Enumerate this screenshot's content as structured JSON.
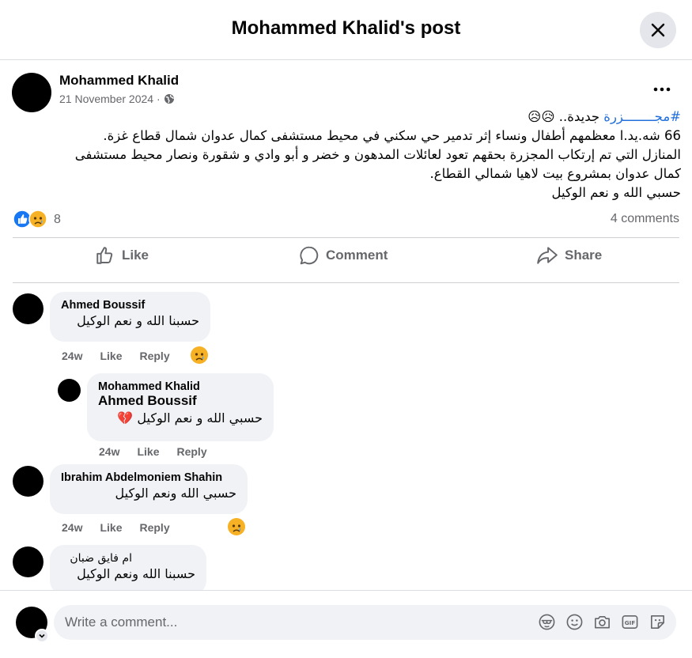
{
  "header": {
    "title": "Mohammed Khalid's post"
  },
  "post": {
    "author": "Mohammed Khalid",
    "date": "21 November 2024 ·",
    "text_lines": [
      "#مجــــــــزرة جديدة.. 😥😥",
      "66 شه.يد.ا معظمهم أطفال ونساء إثر تدمير حي سكني في محيط مستشفى كمال عدوان شمال قطاع غزة.",
      "المنازل التي تم إرتكاب المجزرة بحقهم تعود لعائلات المدهون و خضر و أبو وادي و شقورة ونصار محيط مستشفى",
      "كمال عدوان بمشروع بيت لاهيا شمالي القطاع.",
      "حسبي الله و نعم الوكيل"
    ],
    "hashtag": "#مجــــــــزرة",
    "line1_rest": " جديدة.. 😥😥",
    "reaction_count": "8",
    "comments_count": "4 comments"
  },
  "actions": {
    "like": "Like",
    "comment": "Comment",
    "share": "Share"
  },
  "comments": [
    {
      "name": "Ahmed Boussif",
      "text": "حسبنا الله و نعم الوكيل",
      "time": "24w",
      "like": "Like",
      "reply": "Reply"
    },
    {
      "name": "Mohammed Khalid",
      "mention": "Ahmed Boussif",
      "text": "حسبي الله و نعم الوكيل 💔",
      "time": "24w",
      "like": "Like",
      "reply": "Reply"
    },
    {
      "name": "Ibrahim Abdelmoniem Shahin",
      "text": "حسبي الله ونعم الوكيل",
      "time": "24w",
      "like": "Like",
      "reply": "Reply"
    },
    {
      "name": "ام فايق ضبان",
      "text": "حسبنا الله ونعم الوكيل"
    }
  ],
  "composer": {
    "placeholder": "Write a comment..."
  },
  "icons": {
    "close": "close-icon",
    "globe": "globe-icon",
    "more": "more-icon",
    "like": "thumbs-up-icon",
    "comment": "comment-icon",
    "share": "share-icon",
    "avatar-sticker": "avatar-sticker-icon",
    "emoji": "emoji-icon",
    "camera": "camera-icon",
    "gif": "gif-icon",
    "sticker": "sticker-icon"
  },
  "colors": {
    "link": "#216fdb",
    "like_blue": "#1877f2",
    "muted": "#65676b",
    "bubble": "#f0f2f5"
  }
}
